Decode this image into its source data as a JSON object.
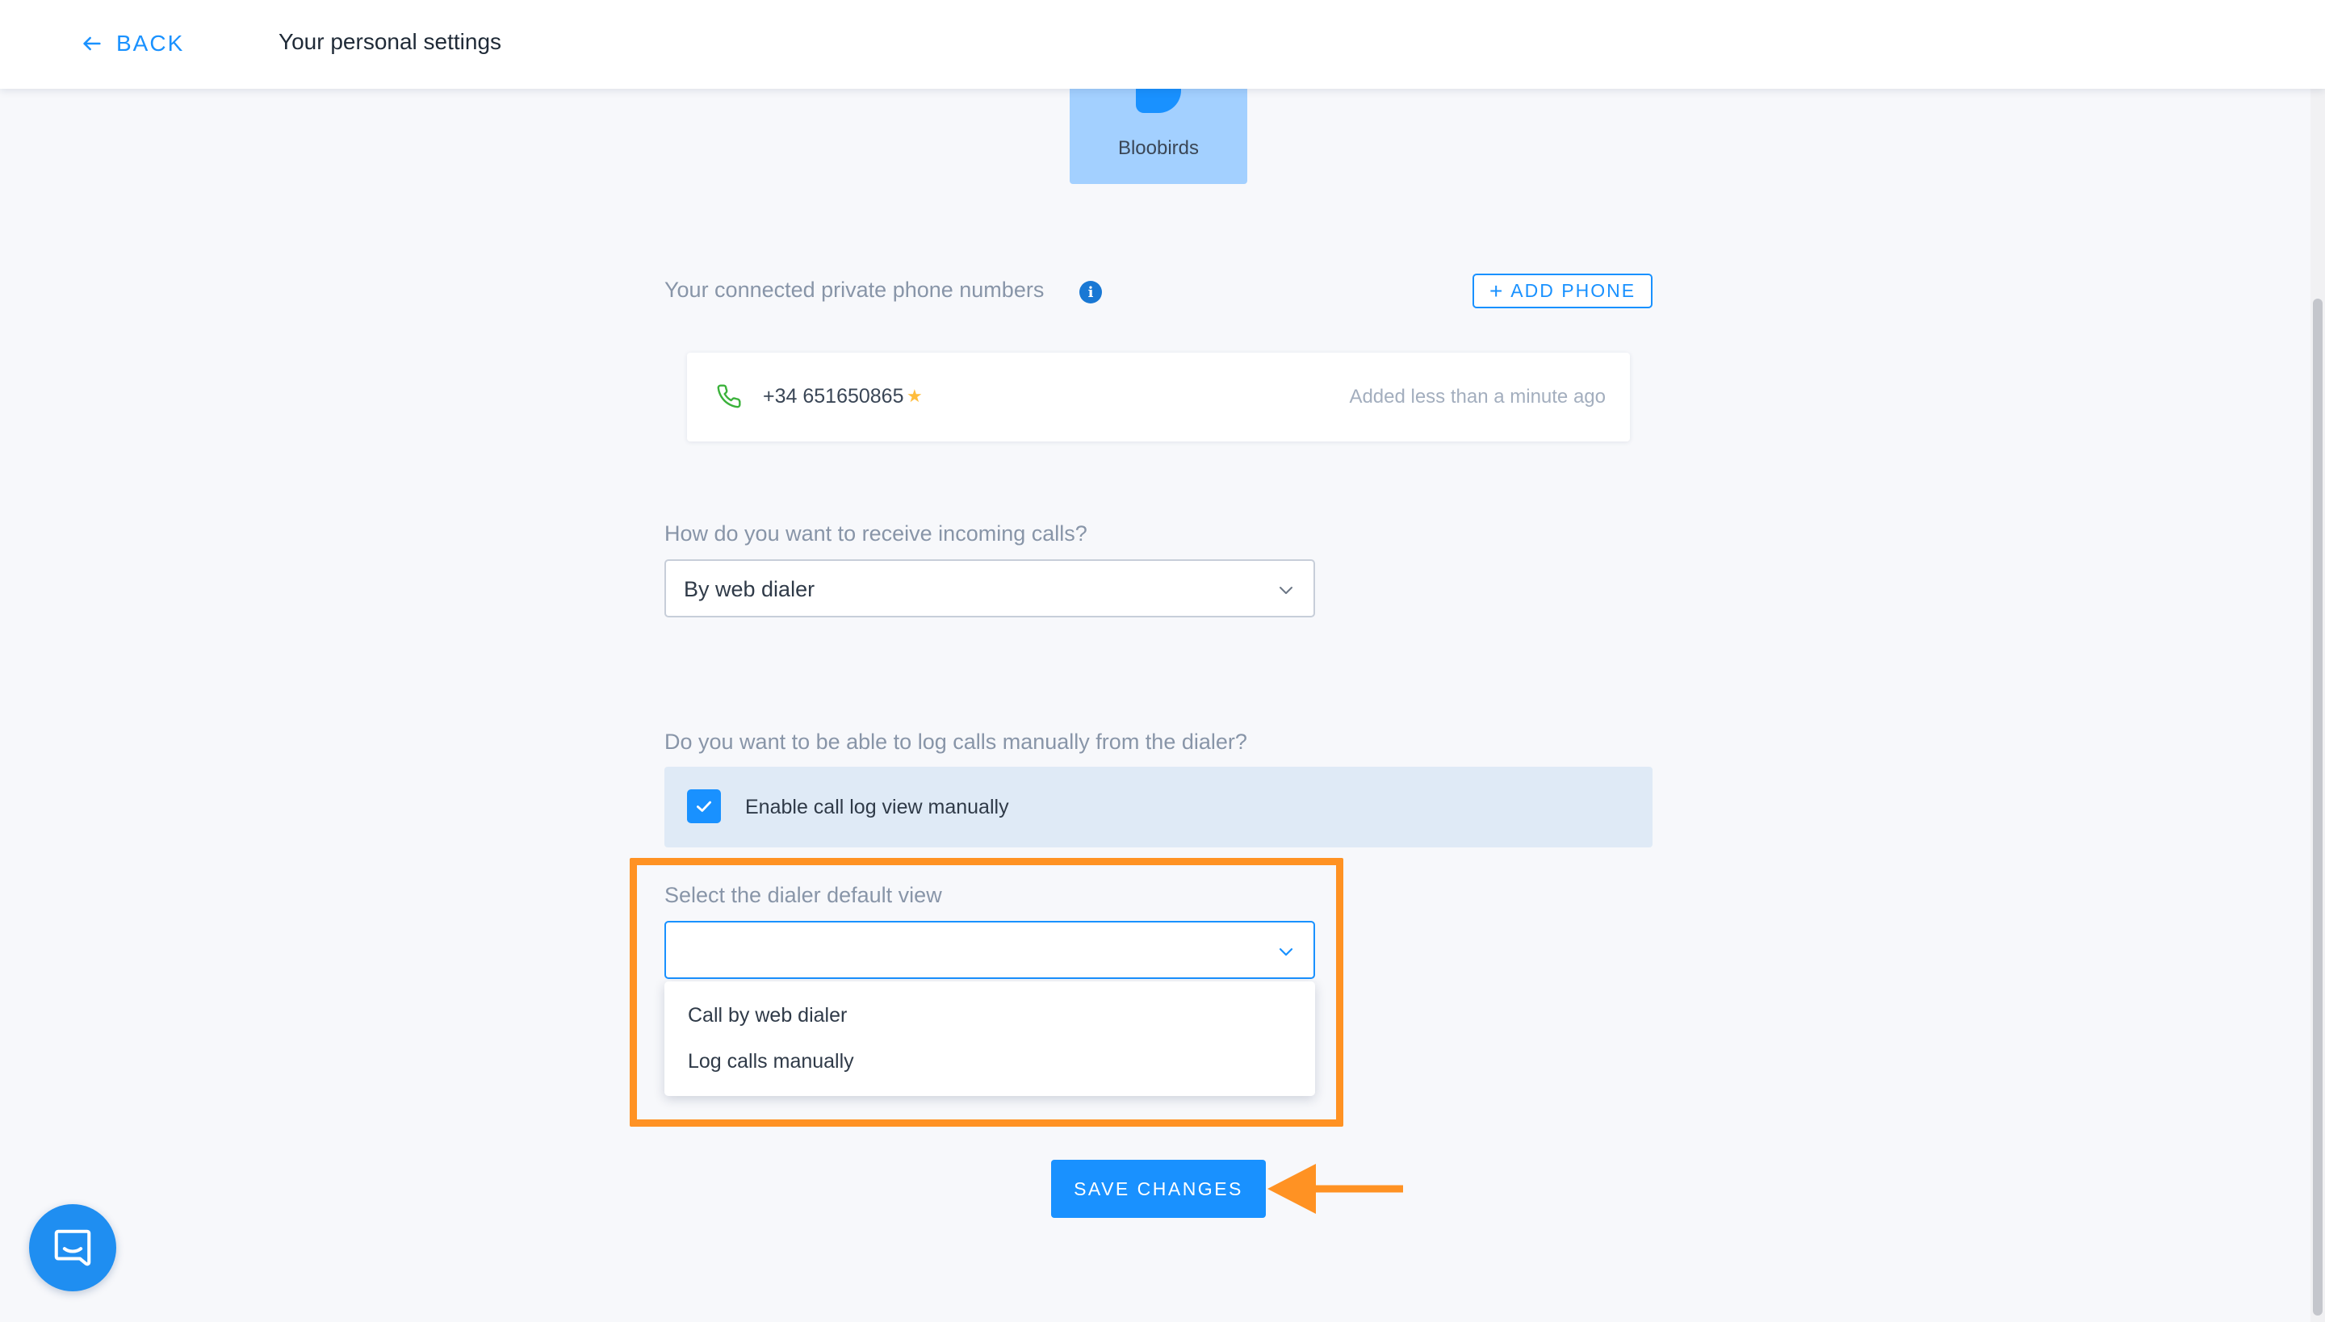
{
  "header": {
    "back_label": "BACK",
    "title": "Your personal settings"
  },
  "account": {
    "name": "Bloobirds"
  },
  "phones": {
    "label": "Your connected private phone numbers",
    "add_button_label": "ADD PHONE",
    "items": [
      {
        "number": "+34 651650865",
        "is_default": true,
        "added": "Added less than a minute ago"
      }
    ]
  },
  "incoming_calls": {
    "label": "How do you want to receive incoming calls?",
    "selected": "By web dialer"
  },
  "call_log": {
    "label": "Do you want to be able to log calls manually from the dialer?",
    "checkbox_label": "Enable call log view manually",
    "checked": true
  },
  "dialer_default_view": {
    "label": "Select the dialer default view",
    "selected": "",
    "options": [
      "Call by web dialer",
      "Log calls manually"
    ]
  },
  "save_label": "SAVE CHANGES",
  "colors": {
    "accent": "#1991ff",
    "highlight": "#ff9223",
    "account_tile": "#a3d0ff",
    "checkbox_row": "#dfeaf6"
  },
  "icons": {
    "back": "arrow-left-icon",
    "info": "info-icon",
    "phone": "phone-icon",
    "star": "star-icon",
    "chevron": "chevron-down-icon",
    "check": "check-icon",
    "chat": "chat-icon"
  }
}
